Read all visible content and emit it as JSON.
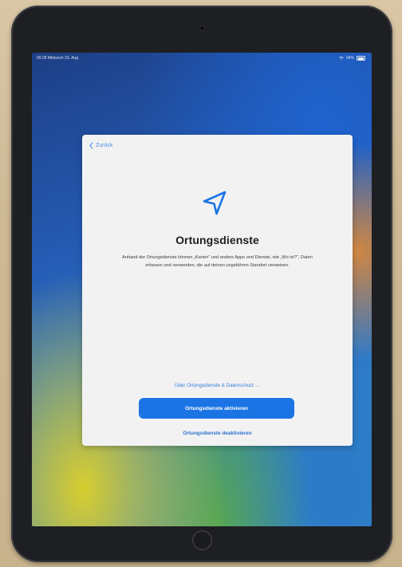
{
  "status_bar": {
    "time_date": "09:28  Mittwoch 23. Aug",
    "battery": "94%"
  },
  "setup": {
    "back_label": "Zurück",
    "icon": "location-arrow-icon",
    "title": "Ortungsdienste",
    "description": "Anhand der Ortungsdienste können „Karten“ und andere Apps und Dienste, wie „Wo ist?“, Daten erfassen und verwenden, die auf deinen ungefähren Standort verweisen.",
    "privacy_link": "Über Ortungsdienste & Datenschutz …",
    "primary_button": "Ortungsdienste aktivieren",
    "secondary_button": "Ortungsdienste deaktivieren"
  },
  "colors": {
    "accent": "#1b74e4",
    "link": "#3b7fd6",
    "sheet_background": "#f2f2f3"
  }
}
